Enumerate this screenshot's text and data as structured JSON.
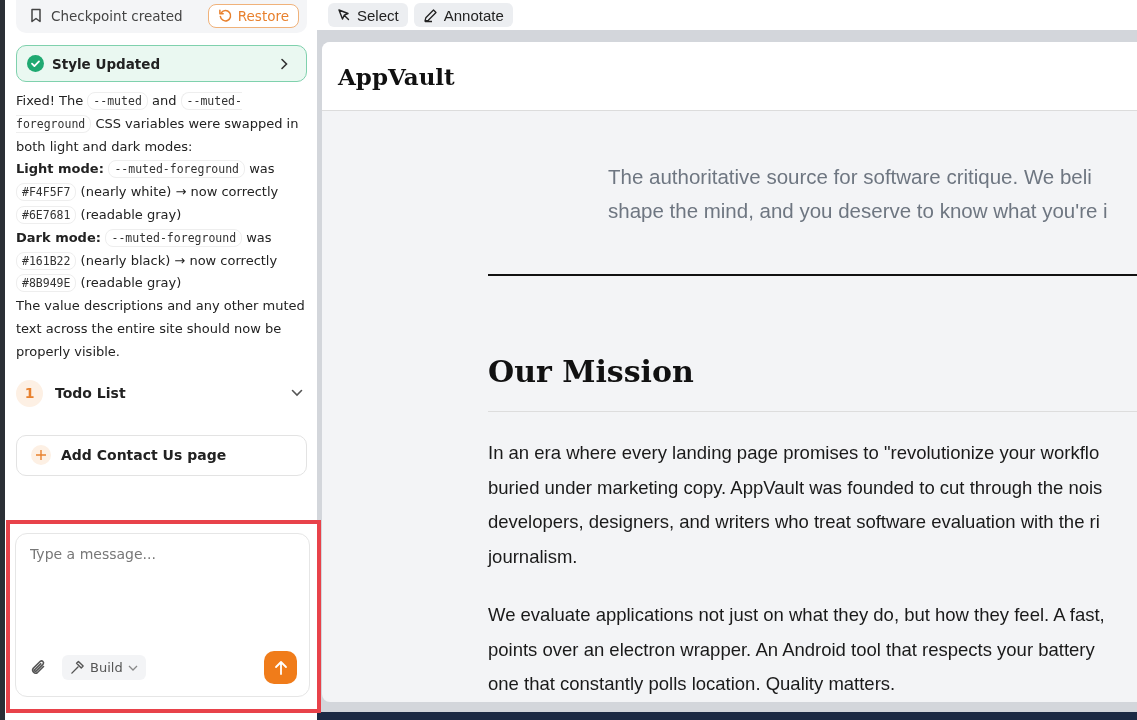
{
  "checkpoint": {
    "label": "Checkpoint created",
    "restore": "Restore"
  },
  "status_card": {
    "title": "Style Updated",
    "done": true
  },
  "message": [
    [
      {
        "kind": "text",
        "text": "Fixed! The "
      },
      {
        "kind": "code",
        "text": "--muted"
      },
      {
        "kind": "text",
        "text": " and "
      },
      {
        "kind": "code",
        "text": "--muted-foreground"
      },
      {
        "kind": "text",
        "text": " CSS variables were swapped in both light and dark modes:"
      }
    ],
    [
      {
        "kind": "bold",
        "text": "Light mode: "
      },
      {
        "kind": "code",
        "text": "--muted-foreground"
      },
      {
        "kind": "text",
        "text": " was "
      },
      {
        "kind": "code",
        "text": "#F4F5F7"
      },
      {
        "kind": "text",
        "text": " (nearly white) → now correctly "
      },
      {
        "kind": "code",
        "text": "#6E7681"
      },
      {
        "kind": "text",
        "text": " (readable gray)"
      }
    ],
    [
      {
        "kind": "bold",
        "text": "Dark mode: "
      },
      {
        "kind": "code",
        "text": "--muted-foreground"
      },
      {
        "kind": "text",
        "text": " was "
      },
      {
        "kind": "code",
        "text": "#161B22"
      },
      {
        "kind": "text",
        "text": " (nearly black) → now correctly "
      },
      {
        "kind": "code",
        "text": "#8B949E"
      },
      {
        "kind": "text",
        "text": " (readable gray)"
      }
    ],
    [
      {
        "kind": "text",
        "text": "The value descriptions and any other muted text across the entire site should now be properly visible."
      }
    ]
  ],
  "todo": {
    "count": "1",
    "title": "Todo List",
    "expanded": false
  },
  "suggestion": {
    "label": "Add Contact Us page"
  },
  "composer": {
    "placeholder": "Type a message...",
    "mode": "Build"
  },
  "toolbar": [
    {
      "label": "Select",
      "kind": "select"
    },
    {
      "label": "Annotate",
      "kind": "annotate"
    }
  ],
  "preview": {
    "brand": "AppVault",
    "subtitle_lines": [
      "The authoritative source for software critique. We beli",
      "shape the mind, and you deserve to know what you're i"
    ],
    "section_title": "Our Mission",
    "paragraphs": [
      [
        "In an era where every landing page promises to \"revolutionize your workflo",
        "buried under marketing copy. AppVault was founded to cut through the nois",
        "developers, designers, and writers who treat software evaluation with the ri",
        "journalism."
      ],
      [
        "We evaluate applications not just on what they do, but how they feel. A fast,",
        "points over an electron wrapper. An Android tool that respects your battery",
        "one that constantly polls location. Quality matters."
      ]
    ]
  }
}
